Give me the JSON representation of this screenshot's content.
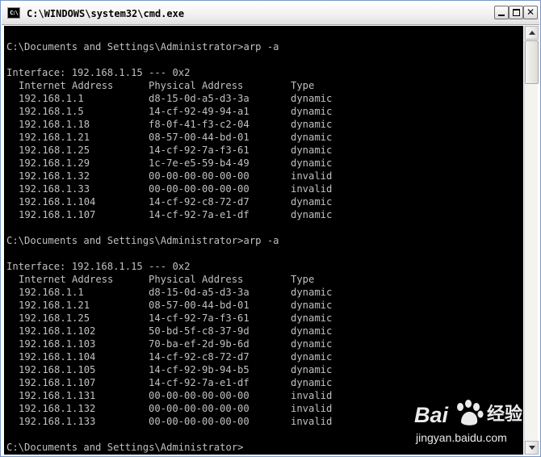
{
  "window": {
    "icon_text": "C:\\",
    "title": "C:\\WINDOWS\\system32\\cmd.exe",
    "controls": {
      "minimize": "_",
      "maximize": "□",
      "close": "✕"
    }
  },
  "console": {
    "blocks": [
      {
        "prompt": "C:\\Documents and Settings\\Administrator>arp -a",
        "interface": "Interface: 192.168.1.15 --- 0x2",
        "headers": [
          "Internet Address",
          "Physical Address",
          "Type"
        ],
        "rows": [
          [
            "192.168.1.1",
            "d8-15-0d-a5-d3-3a",
            "dynamic"
          ],
          [
            "192.168.1.5",
            "14-cf-92-49-94-a1",
            "dynamic"
          ],
          [
            "192.168.1.18",
            "f8-0f-41-f3-c2-04",
            "dynamic"
          ],
          [
            "192.168.1.21",
            "08-57-00-44-bd-01",
            "dynamic"
          ],
          [
            "192.168.1.25",
            "14-cf-92-7a-f3-61",
            "dynamic"
          ],
          [
            "192.168.1.29",
            "1c-7e-e5-59-b4-49",
            "dynamic"
          ],
          [
            "192.168.1.32",
            "00-00-00-00-00-00",
            "invalid"
          ],
          [
            "192.168.1.33",
            "00-00-00-00-00-00",
            "invalid"
          ],
          [
            "192.168.1.104",
            "14-cf-92-c8-72-d7",
            "dynamic"
          ],
          [
            "192.168.1.107",
            "14-cf-92-7a-e1-df",
            "dynamic"
          ]
        ]
      },
      {
        "prompt": "C:\\Documents and Settings\\Administrator>arp -a",
        "interface": "Interface: 192.168.1.15 --- 0x2",
        "headers": [
          "Internet Address",
          "Physical Address",
          "Type"
        ],
        "rows": [
          [
            "192.168.1.1",
            "d8-15-0d-a5-d3-3a",
            "dynamic"
          ],
          [
            "192.168.1.21",
            "08-57-00-44-bd-01",
            "dynamic"
          ],
          [
            "192.168.1.25",
            "14-cf-92-7a-f3-61",
            "dynamic"
          ],
          [
            "192.168.1.102",
            "50-bd-5f-c8-37-9d",
            "dynamic"
          ],
          [
            "192.168.1.103",
            "70-ba-ef-2d-9b-6d",
            "dynamic"
          ],
          [
            "192.168.1.104",
            "14-cf-92-c8-72-d7",
            "dynamic"
          ],
          [
            "192.168.1.105",
            "14-cf-92-9b-94-b5",
            "dynamic"
          ],
          [
            "192.168.1.107",
            "14-cf-92-7a-e1-df",
            "dynamic"
          ],
          [
            "192.168.1.131",
            "00-00-00-00-00-00",
            "invalid"
          ],
          [
            "192.168.1.132",
            "00-00-00-00-00-00",
            "invalid"
          ],
          [
            "192.168.1.133",
            "00-00-00-00-00-00",
            "invalid"
          ]
        ]
      }
    ],
    "final_prompt": "C:\\Documents and Settings\\Administrator>"
  },
  "watermark": {
    "logo": "Bai",
    "logo_suffix": "经验",
    "url": "jingyan.baidu.com"
  },
  "colors": {
    "console_bg": "#000000",
    "console_fg": "#c0c0c0"
  }
}
